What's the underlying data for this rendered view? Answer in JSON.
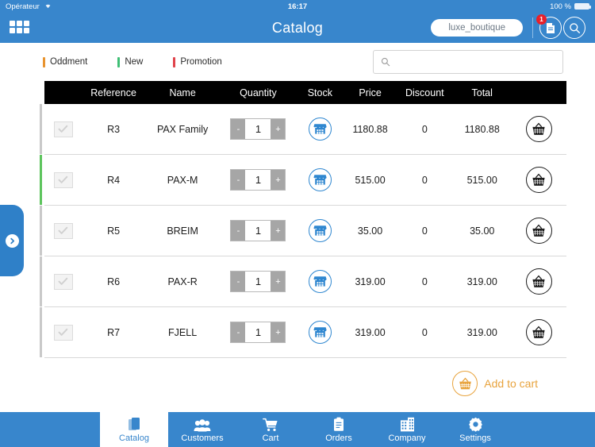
{
  "statusbar": {
    "carrier": "Opérateur",
    "wifi_icon": "wifi-icon",
    "time": "16:17",
    "battery_text": "100 %",
    "battery_icon": "battery-full-icon"
  },
  "navbar": {
    "grid_icon": "grid-menu-icon",
    "title": "Catalog",
    "shop_name": "luxe_boutique",
    "doc_icon": "document-icon",
    "doc_badge": "1",
    "search_icon": "search-icon"
  },
  "filterbar": {
    "legend": [
      {
        "label": "Oddment",
        "color": "#e8932e"
      },
      {
        "label": "New",
        "color": "#3fbf75"
      },
      {
        "label": "Promotion",
        "color": "#e0434b"
      }
    ],
    "search": {
      "icon": "search-icon",
      "value": "",
      "placeholder": ""
    }
  },
  "table": {
    "columns": [
      "",
      "Reference",
      "Name",
      "Quantity",
      "Stock",
      "Price",
      "Discount",
      "Total",
      ""
    ],
    "header": {
      "reference": "Reference",
      "name": "Name",
      "quantity": "Quantity",
      "stock": "Stock",
      "price": "Price",
      "discount": "Discount",
      "total": "Total"
    },
    "stepper": {
      "minus": "-",
      "plus": "+"
    },
    "rows": [
      {
        "checked": true,
        "reference": "R3",
        "name": "PAX Family",
        "quantity": "1",
        "stock_icon": "store-icon",
        "price": "1180.88",
        "discount": "0",
        "total": "1180.88",
        "cart_icon": "basket-icon",
        "accent": "#c9c9c9"
      },
      {
        "checked": true,
        "reference": "R4",
        "name": "PAX-M",
        "quantity": "1",
        "stock_icon": "store-icon",
        "price": "515.00",
        "discount": "0",
        "total": "515.00",
        "cart_icon": "basket-icon",
        "accent": "#5dc45d"
      },
      {
        "checked": true,
        "reference": "R5",
        "name": "BREIM",
        "quantity": "1",
        "stock_icon": "store-icon",
        "price": "35.00",
        "discount": "0",
        "total": "35.00",
        "cart_icon": "basket-icon",
        "accent": "#c9c9c9"
      },
      {
        "checked": true,
        "reference": "R6",
        "name": "PAX-R",
        "quantity": "1",
        "stock_icon": "store-icon",
        "price": "319.00",
        "discount": "0",
        "total": "319.00",
        "cart_icon": "basket-icon",
        "accent": "#c9c9c9"
      },
      {
        "checked": true,
        "reference": "R7",
        "name": "FJELL",
        "quantity": "1",
        "stock_icon": "store-icon",
        "price": "319.00",
        "discount": "0",
        "total": "319.00",
        "cart_icon": "basket-icon",
        "accent": "#c9c9c9"
      }
    ]
  },
  "addcart": {
    "icon": "basket-icon",
    "label": "Add to cart",
    "color": "#e8a33d"
  },
  "drawer": {
    "icon": "chevron-right-icon"
  },
  "tabbar": {
    "tabs": [
      {
        "label": "Catalog",
        "icon": "catalog-icon",
        "active": true
      },
      {
        "label": "Customers",
        "icon": "customers-icon",
        "active": false
      },
      {
        "label": "Cart",
        "icon": "cart-icon",
        "active": false
      },
      {
        "label": "Orders",
        "icon": "orders-icon",
        "active": false
      },
      {
        "label": "Company",
        "icon": "company-icon",
        "active": false
      },
      {
        "label": "Settings",
        "icon": "settings-icon",
        "active": false
      }
    ]
  },
  "colors": {
    "brand_blue": "#3886cc",
    "header_black": "#000000",
    "accent_orange": "#e8a33d",
    "badge_red": "#e8202a"
  }
}
